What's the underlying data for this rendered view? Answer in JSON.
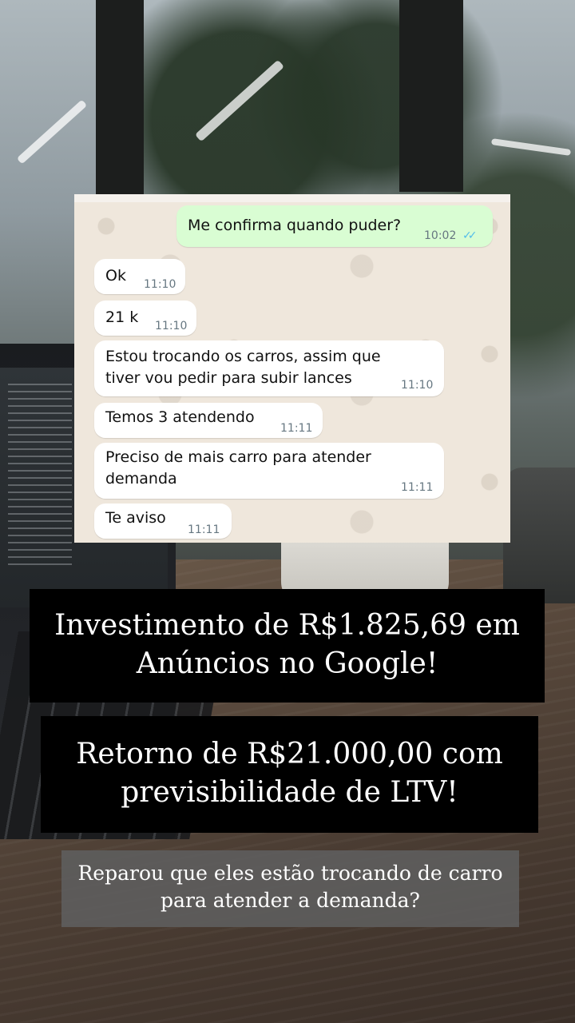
{
  "chat": {
    "outgoing": {
      "text": "Me confirma quando puder?",
      "time": "10:02",
      "status_icon": "double-check-read-icon"
    },
    "incoming": [
      {
        "text": "Ok",
        "time": "11:10"
      },
      {
        "text": "21 k",
        "time": "11:10"
      },
      {
        "text": "Estou trocando os carros, assim que\ntiver vou pedir para subir lances",
        "time": "11:10"
      },
      {
        "text": "Temos 3 atendendo",
        "time": "11:11"
      },
      {
        "text": "Preciso de mais carro para atender\ndemanda",
        "time": "11:11"
      },
      {
        "text": "Te aviso",
        "time": "11:11"
      }
    ]
  },
  "captions": {
    "investment": "Investimento de R$1.825,69 em\nAnúncios no Google!",
    "return": "Retorno de R$21.000,00 com\nprevisibilidade de LTV!",
    "question": "Reparou que eles estão trocando de carro\npara atender a demanda?"
  },
  "colors": {
    "chat_background": "#efe7dc",
    "outgoing_bubble": "#d9fdd3",
    "incoming_bubble": "#ffffff",
    "read_ticks": "#53bdeb",
    "caption_box": "#000000"
  }
}
